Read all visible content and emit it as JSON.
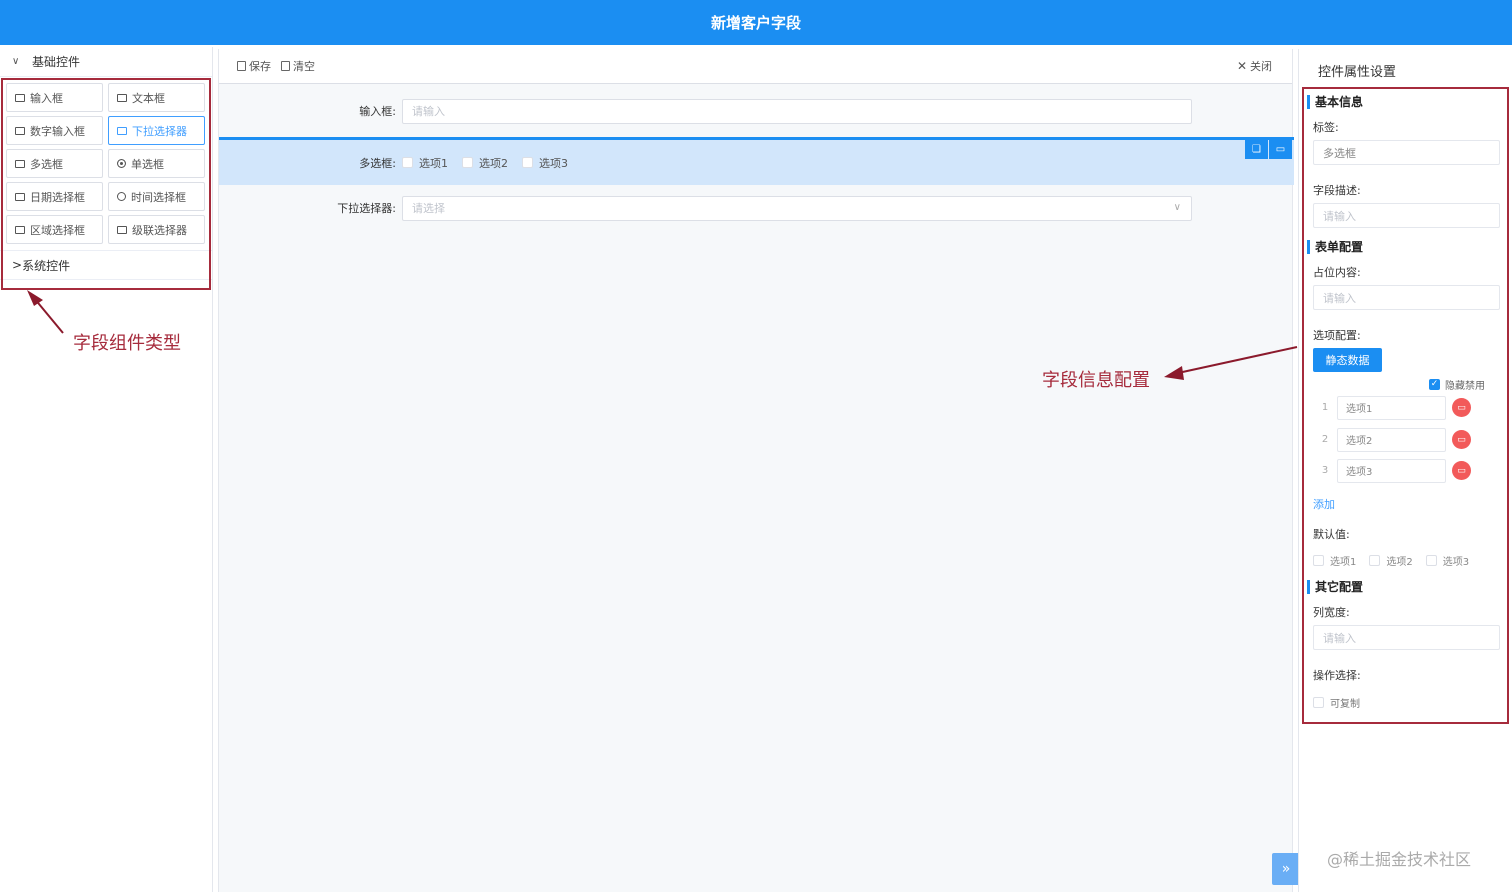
{
  "header": {
    "title": "新增客户字段"
  },
  "left": {
    "basic_group": "基础控件",
    "controls": [
      {
        "label": "输入框",
        "icon": "input-icon"
      },
      {
        "label": "文本框",
        "icon": "textarea-icon"
      },
      {
        "label": "数字输入框",
        "icon": "number-input-icon"
      },
      {
        "label": "下拉选择器",
        "icon": "select-icon",
        "active": true
      },
      {
        "label": "多选框",
        "icon": "checkbox-icon"
      },
      {
        "label": "单选框",
        "icon": "radio-icon"
      },
      {
        "label": "日期选择框",
        "icon": "calendar-icon"
      },
      {
        "label": "时间选择框",
        "icon": "clock-icon"
      },
      {
        "label": "区域选择框",
        "icon": "region-icon"
      },
      {
        "label": "级联选择器",
        "icon": "cascader-icon"
      }
    ],
    "system_group": "系统控件"
  },
  "toolbar": {
    "save": "保存",
    "clear": "清空",
    "close": "关闭"
  },
  "form": {
    "input_label": "输入框:",
    "input_placeholder": "请输入",
    "checkbox_label": "多选框:",
    "checkbox_options": [
      "选项1",
      "选项2",
      "选项3"
    ],
    "select_label": "下拉选择器:",
    "select_placeholder": "请选择"
  },
  "props": {
    "title": "控件属性设置",
    "basic_section": "基本信息",
    "label_label": "标签:",
    "label_value": "多选框",
    "desc_label": "字段描述:",
    "desc_placeholder": "请输入",
    "form_section": "表单配置",
    "placeholder_label": "占位内容:",
    "placeholder_placeholder": "请输入",
    "options_label": "选项配置:",
    "static_button": "静态数据",
    "hide_disabled": "隐藏禁用",
    "options": [
      {
        "index": "1",
        "value": "选项1"
      },
      {
        "index": "2",
        "value": "选项2"
      },
      {
        "index": "3",
        "value": "选项3"
      }
    ],
    "add": "添加",
    "default_label": "默认值:",
    "default_options": [
      "选项1",
      "选项2",
      "选项3"
    ],
    "other_section": "其它配置",
    "width_label": "列宽度:",
    "width_placeholder": "请输入",
    "action_label": "操作选择:",
    "copyable": "可复制"
  },
  "annotations": {
    "left_note": "字段组件类型",
    "right_note": "字段信息配置"
  },
  "watermark": "@稀土掘金技术社区",
  "colors": {
    "primary": "#1b8ef2",
    "annotation": "#a62b3c",
    "danger": "#f25a5a"
  }
}
